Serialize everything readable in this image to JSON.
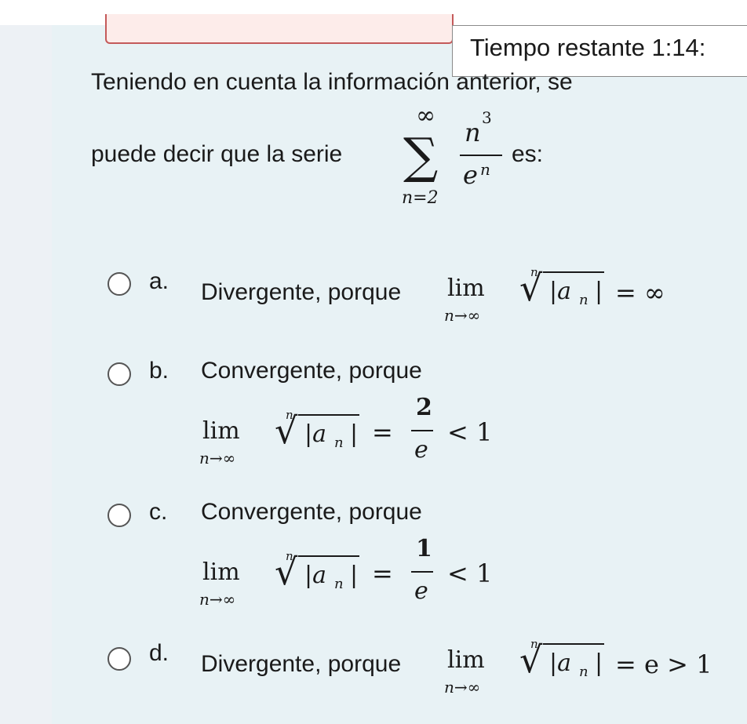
{
  "timer": {
    "label": "Tiempo restante 1:14:"
  },
  "question": {
    "line1": "Teniendo en cuenta la información anterior, se",
    "line2": "puede decir que la serie",
    "suffix": "es:",
    "series": {
      "sum": "∑",
      "upper": "∞",
      "lower": "n=2",
      "numerator": "n",
      "num_exp": "3",
      "denominator": "e",
      "den_exp": "n"
    }
  },
  "math": {
    "lim": "lim",
    "lim_sub": "n→∞",
    "root_index": "n",
    "radicand": "|a",
    "radicand_sub": "n",
    "radicand_end": "|"
  },
  "options": [
    {
      "letter": "a.",
      "text": "Divergente, porque",
      "result": "= ∞"
    },
    {
      "letter": "b.",
      "text": "Convergente, porque",
      "eq": "=",
      "frac_num": "2",
      "frac_den": "e",
      "tail": "< 1"
    },
    {
      "letter": "c.",
      "text": "Convergente, porque",
      "eq": "=",
      "frac_num": "1",
      "frac_den": "e",
      "tail": "< 1"
    },
    {
      "letter": "d.",
      "text": "Divergente, porque",
      "result": "= e > 1"
    }
  ]
}
